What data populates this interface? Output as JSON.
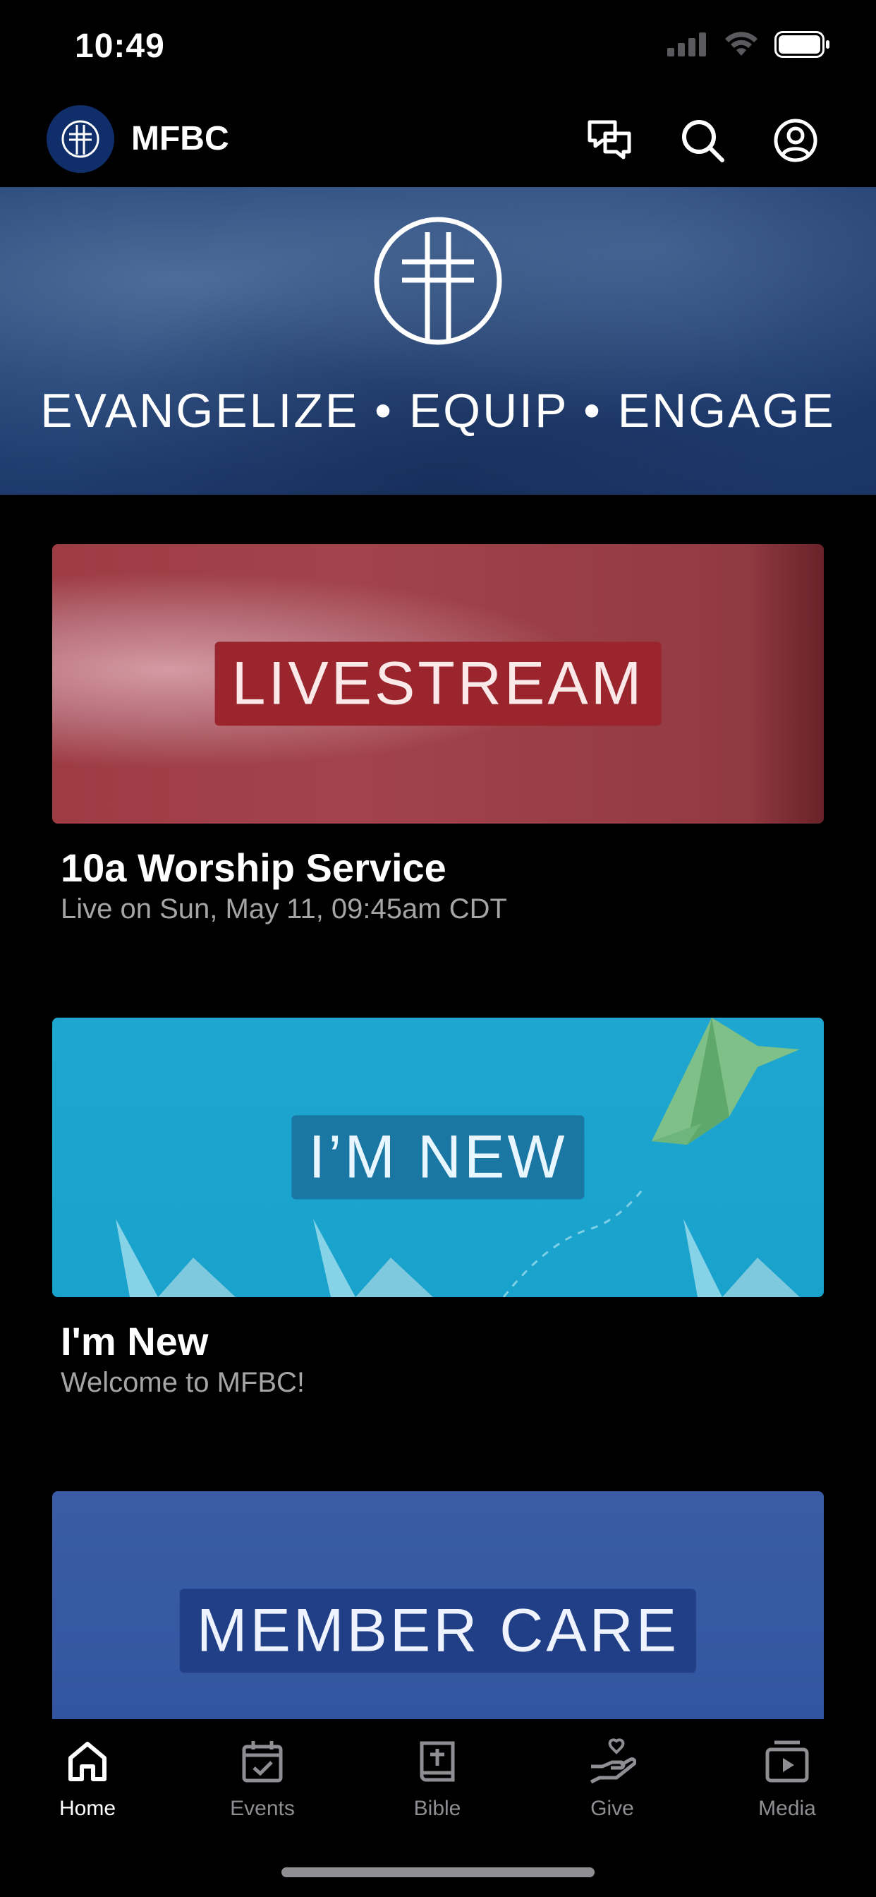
{
  "status_bar": {
    "time": "10:49"
  },
  "header": {
    "title": "MFBC"
  },
  "hero": {
    "tagline": "EVANGELIZE • EQUIP • ENGAGE"
  },
  "cards": [
    {
      "image_label": "LIVESTREAM",
      "title": "10a Worship Service",
      "subtitle": "Live on Sun, May 11, 09:45am CDT"
    },
    {
      "image_label": "I’M NEW",
      "title": "I'm New",
      "subtitle": "Welcome to MFBC!"
    },
    {
      "image_label": "MEMBER CARE"
    }
  ],
  "tabs": [
    {
      "label": "Home",
      "icon": "home-icon",
      "active": true
    },
    {
      "label": "Events",
      "icon": "calendar-icon"
    },
    {
      "label": "Bible",
      "icon": "bible-icon"
    },
    {
      "label": "Give",
      "icon": "give-icon"
    },
    {
      "label": "Media",
      "icon": "media-icon"
    }
  ],
  "colors": {
    "background": "#000000",
    "hero_blue": "#1f3c6f",
    "livestream_red": "#9e3c44",
    "new_cyan": "#1ea6d0",
    "member_blue": "#3558a3",
    "tab_inactive": "#8e8e93"
  }
}
